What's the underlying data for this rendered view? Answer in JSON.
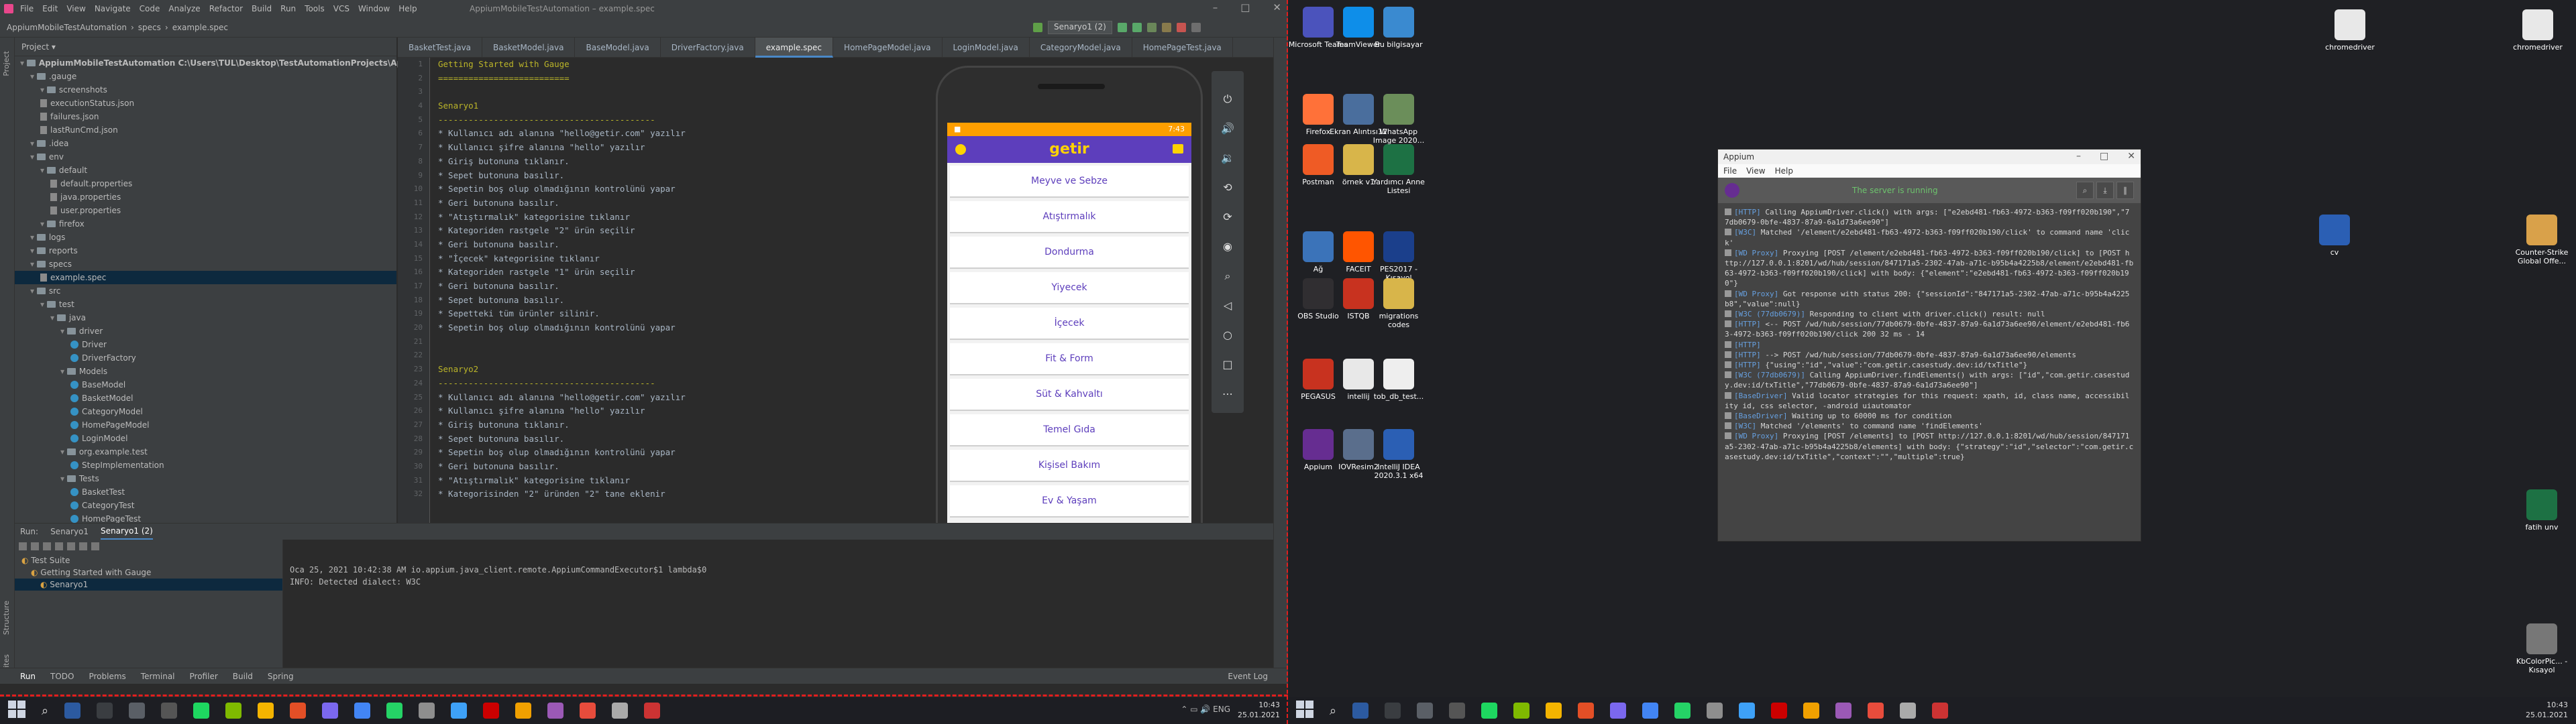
{
  "ide": {
    "window_title": "AppiumMobileTestAutomation – example.spec",
    "menu": [
      "File",
      "Edit",
      "View",
      "Navigate",
      "Code",
      "Analyze",
      "Refactor",
      "Build",
      "Run",
      "Tools",
      "VCS",
      "Window",
      "Help"
    ],
    "breadcrumb": [
      "AppiumMobileTestAutomation",
      "specs",
      "example.spec"
    ],
    "run_config": "Senaryo1 (2)",
    "tabs": [
      "BasketTest.java",
      "BasketModel.java",
      "BaseModel.java",
      "DriverFactory.java",
      "example.spec",
      "HomePageModel.java",
      "LoginModel.java",
      "CategoryModel.java",
      "HomePageTest.java"
    ],
    "active_tab": "example.spec",
    "project": {
      "header": "Project",
      "tree": [
        {
          "label": "AppiumMobileTestAutomation C:\\Users\\TUL\\Desktop\\TestAutomationProjects\\AppiumMobileTe",
          "indent": 0,
          "kind": "folder",
          "bold": true
        },
        {
          "label": ".gauge",
          "indent": 1,
          "kind": "folder"
        },
        {
          "label": "screenshots",
          "indent": 2,
          "kind": "folder"
        },
        {
          "label": "executionStatus.json",
          "indent": 2,
          "kind": "file"
        },
        {
          "label": "failures.json",
          "indent": 2,
          "kind": "file"
        },
        {
          "label": "lastRunCmd.json",
          "indent": 2,
          "kind": "file"
        },
        {
          "label": ".idea",
          "indent": 1,
          "kind": "folder"
        },
        {
          "label": "env",
          "indent": 1,
          "kind": "folder"
        },
        {
          "label": "default",
          "indent": 2,
          "kind": "folder"
        },
        {
          "label": "default.properties",
          "indent": 3,
          "kind": "file"
        },
        {
          "label": "java.properties",
          "indent": 3,
          "kind": "file"
        },
        {
          "label": "user.properties",
          "indent": 3,
          "kind": "file"
        },
        {
          "label": "firefox",
          "indent": 2,
          "kind": "folder"
        },
        {
          "label": "logs",
          "indent": 1,
          "kind": "folder"
        },
        {
          "label": "reports",
          "indent": 1,
          "kind": "folder"
        },
        {
          "label": "specs",
          "indent": 1,
          "kind": "folder"
        },
        {
          "label": "example.spec",
          "indent": 2,
          "kind": "file"
        },
        {
          "label": "src",
          "indent": 1,
          "kind": "folder"
        },
        {
          "label": "test",
          "indent": 2,
          "kind": "folder"
        },
        {
          "label": "java",
          "indent": 3,
          "kind": "folder"
        },
        {
          "label": "driver",
          "indent": 4,
          "kind": "folder"
        },
        {
          "label": "Driver",
          "indent": 5,
          "kind": "class"
        },
        {
          "label": "DriverFactory",
          "indent": 5,
          "kind": "class"
        },
        {
          "label": "Models",
          "indent": 4,
          "kind": "folder"
        },
        {
          "label": "BaseModel",
          "indent": 5,
          "kind": "class"
        },
        {
          "label": "BasketModel",
          "indent": 5,
          "kind": "class"
        },
        {
          "label": "CategoryModel",
          "indent": 5,
          "kind": "class"
        },
        {
          "label": "HomePageModel",
          "indent": 5,
          "kind": "class"
        },
        {
          "label": "LoginModel",
          "indent": 5,
          "kind": "class"
        },
        {
          "label": "org.example.test",
          "indent": 4,
          "kind": "folder"
        },
        {
          "label": "StepImplementation",
          "indent": 5,
          "kind": "class"
        },
        {
          "label": "Tests",
          "indent": 4,
          "kind": "folder"
        },
        {
          "label": "BasketTest",
          "indent": 5,
          "kind": "class"
        },
        {
          "label": "CategoryTest",
          "indent": 5,
          "kind": "class"
        },
        {
          "label": "HomePageTest",
          "indent": 5,
          "kind": "class"
        }
      ]
    },
    "code_lines": [
      {
        "t": "Getting Started with Gauge",
        "c": "h"
      },
      {
        "t": "==========================",
        "c": "h"
      },
      {
        "t": "",
        "c": ""
      },
      {
        "t": "Senaryo1",
        "c": "h"
      },
      {
        "t": "-------------------------------------------",
        "c": "h"
      },
      {
        "t": "* Kullanıcı adı alanına \"hello@getir.com\" yazılır",
        "c": ""
      },
      {
        "t": "* Kullanıcı şifre alanına \"hello\" yazılır",
        "c": ""
      },
      {
        "t": "* Giriş butonuna tıklanır.",
        "c": ""
      },
      {
        "t": "* Sepet butonuna basılır.",
        "c": ""
      },
      {
        "t": "* Sepetin boş olup olmadığının kontrolünü yapar",
        "c": ""
      },
      {
        "t": "* Geri butonuna basılır.",
        "c": ""
      },
      {
        "t": "* \"Atıştırmalık\" kategorisine tıklanır",
        "c": ""
      },
      {
        "t": "* Kategoriden rastgele \"2\" ürün seçilir",
        "c": ""
      },
      {
        "t": "* Geri butonuna basılır.",
        "c": ""
      },
      {
        "t": "* \"İçecek\" kategorisine tıklanır",
        "c": ""
      },
      {
        "t": "* Kategoriden rastgele \"1\" ürün seçilir",
        "c": ""
      },
      {
        "t": "* Geri butonuna basılır.",
        "c": ""
      },
      {
        "t": "* Sepet butonuna basılır.",
        "c": ""
      },
      {
        "t": "* Sepetteki tüm ürünler silinir.",
        "c": ""
      },
      {
        "t": "* Sepetin boş olup olmadığının kontrolünü yapar",
        "c": ""
      },
      {
        "t": "",
        "c": ""
      },
      {
        "t": "",
        "c": ""
      },
      {
        "t": "Senaryo2",
        "c": "h"
      },
      {
        "t": "-------------------------------------------",
        "c": "h"
      },
      {
        "t": "* Kullanıcı adı alanına \"hello@getir.com\" yazılır",
        "c": ""
      },
      {
        "t": "* Kullanıcı şifre alanına \"hello\" yazılır",
        "c": ""
      },
      {
        "t": "* Giriş butonuna tıklanır.",
        "c": ""
      },
      {
        "t": "* Sepet butonuna basılır.",
        "c": ""
      },
      {
        "t": "* Sepetin boş olup olmadığının kontrolünü yapar",
        "c": ""
      },
      {
        "t": "* Geri butonuna basılır.",
        "c": ""
      },
      {
        "t": "* \"Atıştırmalık\" kategorisine tıklanır",
        "c": ""
      },
      {
        "t": "* Kategorisinden \"2\" üründen \"2\" tane eklenir",
        "c": ""
      }
    ],
    "run_panel": {
      "header": "Run:",
      "tabs": [
        "Senaryo1",
        "Senaryo1 (2)"
      ],
      "tree": [
        {
          "label": "Test Suite",
          "indent": 0
        },
        {
          "label": "Getting Started with Gauge",
          "indent": 1
        },
        {
          "label": "Senaryo1",
          "indent": 2,
          "sel": true
        }
      ],
      "console": [
        "Oca 25, 2021 10:42:38 AM io.appium.java_client.remote.AppiumCommandExecutor$1 lambda$0",
        "INFO: Detected dialect: W3C"
      ]
    },
    "bottom_tools": [
      "Run",
      "TODO",
      "Problems",
      "Terminal",
      "Profiler",
      "Build",
      "Spring"
    ],
    "event_log": "Event Log",
    "side_tabs": [
      "Project",
      "Structure",
      "Favorites"
    ]
  },
  "phone": {
    "time": "7:43",
    "app_logo": "getir",
    "categories": [
      "Meyve ve Sebze",
      "Atıştırmalık",
      "Dondurma",
      "Yiyecek",
      "İçecek",
      "Fit & Form",
      "Süt & Kahvaltı",
      "Temel Gıda",
      "Kişisel Bakım",
      "Ev & Yaşam"
    ]
  },
  "taskbar": {
    "time_left": "10:43",
    "date_left": "25.01.2021",
    "time_right": "10:43",
    "date_right": "25.01.2021",
    "icons": [
      "#2c5aa0",
      "#3a3d41",
      "#5a5f66",
      "#555",
      "#1ed760",
      "#7fba00",
      "#f4b400",
      "#e34f26",
      "#7b68ee",
      "#4285f4",
      "#25d366",
      "#8e8e8e",
      "#3ea1f7",
      "#cc0000",
      "#f0a000",
      "#9b59b6",
      "#e74c3c",
      "#aaa",
      "#cc3333"
    ]
  },
  "desktop": {
    "left_icons": [
      {
        "label": "Microsoft Teams",
        "color": "#4b53bc"
      },
      {
        "label": "TeamViewer",
        "color": "#0e8ee9"
      },
      {
        "label": "Bu bilgisayar",
        "color": "#3a8ad0"
      },
      {
        "label": "Firefox",
        "color": "#ff7139"
      },
      {
        "label": "Ekran Alıntısı12",
        "color": "#4a6e9d"
      },
      {
        "label": "WhatsApp Image 2020...",
        "color": "#6b8e5a"
      },
      {
        "label": "Postman",
        "color": "#ef5b25"
      },
      {
        "label": "örnek v1",
        "color": "#d8b54a"
      },
      {
        "label": "Yardımcı Anne Listesi",
        "color": "#1d7144"
      },
      {
        "label": "Ağ",
        "color": "#3b73b9"
      },
      {
        "label": "FACEIT",
        "color": "#ff5500"
      },
      {
        "label": "PES2017 - Kısayol",
        "color": "#1b3f8b"
      },
      {
        "label": "OBS Studio",
        "color": "#302e31"
      },
      {
        "label": "ISTQB",
        "color": "#c8321f"
      },
      {
        "label": "migrations codes",
        "color": "#d8b54a"
      },
      {
        "label": "PEGASUS",
        "color": "#c8321f"
      },
      {
        "label": "intellij",
        "color": "#e8e8e8"
      },
      {
        "label": "tob_db_test...",
        "color": "#eeeeee"
      },
      {
        "label": "Appium",
        "color": "#662d91"
      },
      {
        "label": "IOVResim2",
        "color": "#5a6e8c"
      },
      {
        "label": "IntelliJ IDEA 2020.3.1 x64",
        "color": "#2b5fb4"
      }
    ],
    "right_icons": [
      {
        "label": "chromedriver",
        "color": "#e8e8e8"
      },
      {
        "label": "chromedriver",
        "color": "#e8e8e8"
      },
      {
        "label": "cv",
        "color": "#2b5fb4"
      },
      {
        "label": "Counter-Strike Global Offe...",
        "color": "#d9a14a"
      },
      {
        "label": "fatih unv",
        "color": "#1d7144"
      },
      {
        "label": "KbColorPic... - Kısayol",
        "color": "#777"
      }
    ]
  },
  "appium": {
    "title": "Appium",
    "menu": [
      "File",
      "View",
      "Help"
    ],
    "status": "The server is running",
    "log": [
      {
        "tag": "[HTTP]",
        "text": "Calling AppiumDriver.click() with args: [\"e2ebd481-fb63-4972-b363-f09ff020b190\",\"77db0679-0bfe-4837-87a9-6a1d73a6ee90\"]"
      },
      {
        "tag": "[W3C]",
        "text": "Matched '/element/e2ebd481-fb63-4972-b363-f09ff020b190/click' to command name 'click'"
      },
      {
        "tag": "[WD Proxy]",
        "text": "Proxying [POST /element/e2ebd481-fb63-4972-b363-f09ff020b190/click] to [POST http://127.0.0.1:8201/wd/hub/session/847171a5-2302-47ab-a71c-b95b4a4225b8/element/e2ebd481-fb63-4972-b363-f09ff020b190/click] with body: {\"element\":\"e2ebd481-fb63-4972-b363-f09ff020b190\"}"
      },
      {
        "tag": "[WD Proxy]",
        "text": "Got response with status 200: {\"sessionId\":\"847171a5-2302-47ab-a71c-b95b4a4225b8\",\"value\":null}"
      },
      {
        "tag": "[W3C (77db0679)]",
        "text": "Responding to client with driver.click() result: null"
      },
      {
        "tag": "[HTTP]",
        "text": "<-- POST /wd/hub/session/77db0679-0bfe-4837-87a9-6a1d73a6ee90/element/e2ebd481-fb63-4972-b363-f09ff020b190/click 200 32 ms - 14"
      },
      {
        "tag": "[HTTP]",
        "text": ""
      },
      {
        "tag": "[HTTP]",
        "text": "--> POST /wd/hub/session/77db0679-0bfe-4837-87a9-6a1d73a6ee90/elements"
      },
      {
        "tag": "[HTTP]",
        "text": "{\"using\":\"id\",\"value\":\"com.getir.casestudy.dev:id/txTitle\"}"
      },
      {
        "tag": "[W3C (77db0679)]",
        "text": "Calling AppiumDriver.findElements() with args: [\"id\",\"com.getir.casestudy.dev:id/txTitle\",\"77db0679-0bfe-4837-87a9-6a1d73a6ee90\"]"
      },
      {
        "tag": "[BaseDriver]",
        "text": "Valid locator strategies for this request: xpath, id, class name, accessibility id, css selector, -android uiautomator"
      },
      {
        "tag": "[BaseDriver]",
        "text": "Waiting up to 60000 ms for condition"
      },
      {
        "tag": "[W3C]",
        "text": "Matched '/elements' to command name 'findElements'"
      },
      {
        "tag": "[WD Proxy]",
        "text": "Proxying [POST /elements] to [POST http://127.0.0.1:8201/wd/hub/session/847171a5-2302-47ab-a71c-b95b4a4225b8/elements] with body: {\"strategy\":\"id\",\"selector\":\"com.getir.casestudy.dev:id/txTitle\",\"context\":\"\",\"multiple\":true}"
      }
    ]
  }
}
